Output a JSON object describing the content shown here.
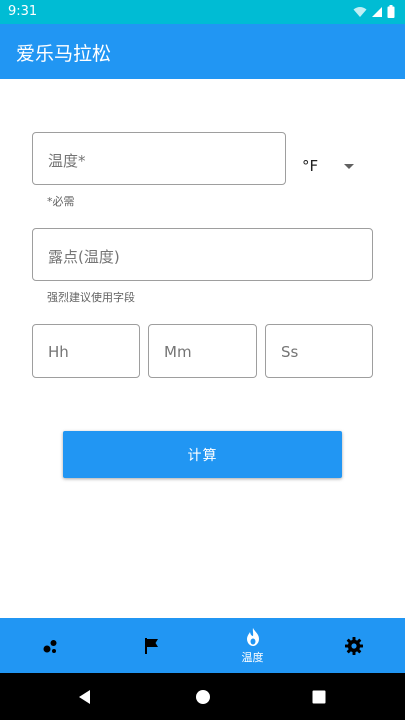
{
  "status_bar": {
    "time": "9:31"
  },
  "app_bar": {
    "title": "爱乐马拉松"
  },
  "form": {
    "temperature": {
      "placeholder": "温度*",
      "helper": "*必需"
    },
    "unit": {
      "selected": "°F"
    },
    "dew_point": {
      "placeholder": "露点(温度)",
      "helper": "强烈建议使用字段"
    },
    "time": {
      "hours_placeholder": "Hh",
      "minutes_placeholder": "Mm",
      "seconds_placeholder": "Ss"
    },
    "calculate_label": "计算"
  },
  "bottom_nav": {
    "items": [
      {
        "icon": "dots-icon",
        "label": ""
      },
      {
        "icon": "flag-icon",
        "label": ""
      },
      {
        "icon": "flame-icon",
        "label": "温度",
        "active": true
      },
      {
        "icon": "gear-icon",
        "label": ""
      }
    ]
  },
  "colors": {
    "status_bar": "#00BCD4",
    "primary": "#2196F3",
    "system_nav": "#000000"
  }
}
